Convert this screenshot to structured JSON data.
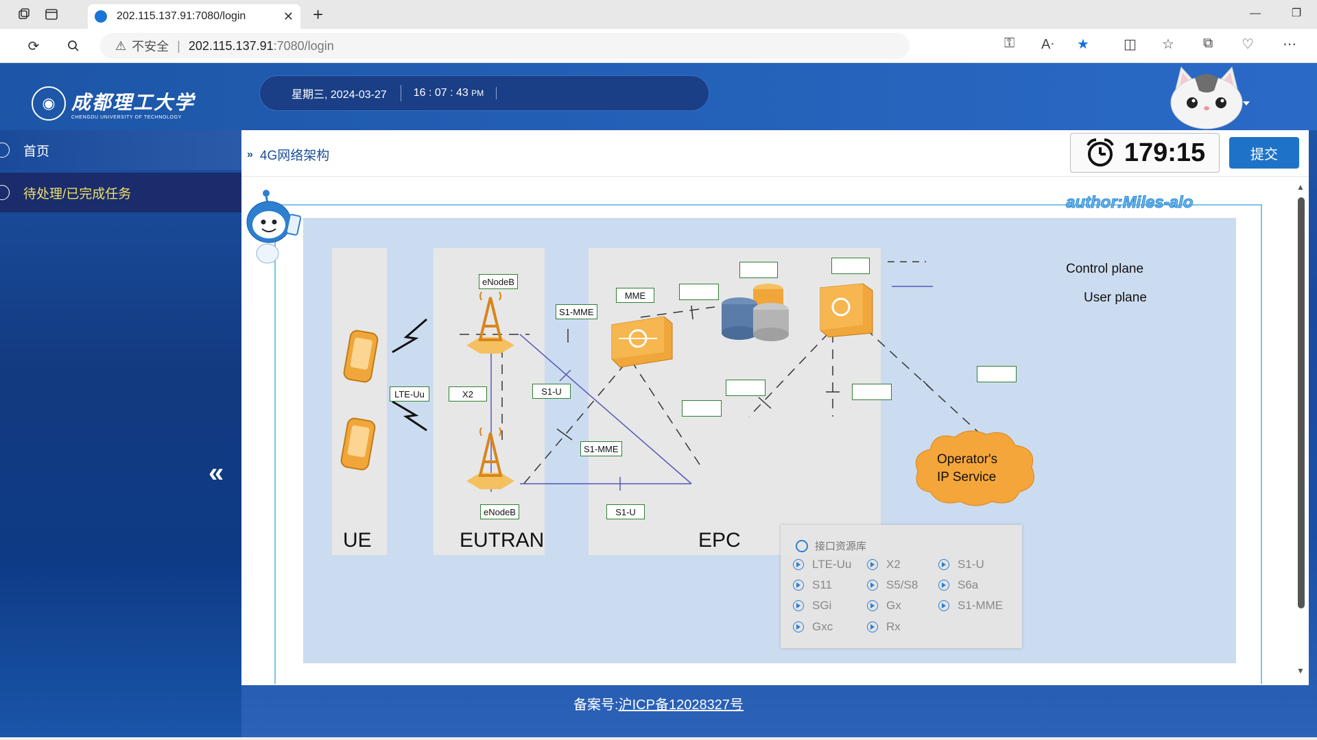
{
  "browser": {
    "tab_title": "202.115.137.91:7080/login",
    "new_tab_label": "+",
    "close_tab_glyph": "✕",
    "insecure_label": "不安全",
    "url_separator": "|",
    "url_host": "202.115.137.91",
    "url_path": ":7080/login"
  },
  "header": {
    "logo_cn": "成都理工大学",
    "logo_en": "CHENGDU UNIVERSITY OF TECHNOLOGY",
    "date_text": "星期三, 2024-03-27",
    "time_text": "16 : 07 : 43",
    "ampm": "PM"
  },
  "sidebar": {
    "items": [
      {
        "label": "首页"
      },
      {
        "label": "待处理/已完成任务"
      }
    ],
    "collapse_glyph": "«"
  },
  "main": {
    "breadcrumb_arrow": "»",
    "breadcrumb": "4G网络架构",
    "timer": "179:15",
    "submit_label": "提交",
    "author": "author:Miles-alo"
  },
  "diagram": {
    "zones": [
      {
        "label": "UE"
      },
      {
        "label": "EUTRAN"
      },
      {
        "label": "EPC"
      }
    ],
    "labels": {
      "enodeb_top": "eNodeB",
      "enodeb_bottom": "eNodeB",
      "mme": "MME",
      "s1mme_top": "S1-MME",
      "s1mme_mid": "S1-MME",
      "lte_uu": "LTE-Uu",
      "x2": "X2",
      "s1u_mid": "S1-U",
      "s1u_bottom": "S1-U"
    },
    "legend": {
      "control": "Control plane",
      "user": "User plane"
    },
    "cloud": {
      "line1": "Operator's",
      "line2": "IP Service"
    }
  },
  "popup": {
    "title": "接口资源库",
    "items": [
      "LTE-Uu",
      "X2",
      "S1-U",
      "S11",
      "S5/S8",
      "S6a",
      "SGi",
      "Gx",
      "S1-MME",
      "Gxc",
      "Rx"
    ]
  },
  "footer": {
    "prefix": "备案号:",
    "icp": "沪ICP备12028327号"
  },
  "colors": {
    "accent": "#1e73c8",
    "header_blue": "#1d56a7",
    "tasks_text": "#f0e06a",
    "diagram_bg": "#ccdcf0",
    "label_border": "#2e7d32",
    "author_text": "#6ab7ee"
  }
}
